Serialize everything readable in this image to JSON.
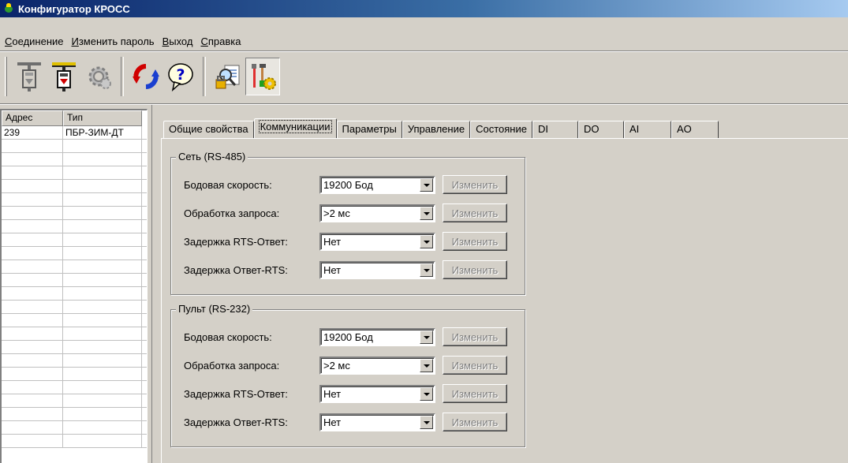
{
  "window": {
    "title": "Конфигуратор КРОСС"
  },
  "menu": [
    "Соединение",
    "Изменить пароль",
    "Выход",
    "Справка"
  ],
  "toolbar": {
    "icons": [
      "connect-device-icon",
      "disconnect-device-icon",
      "settings-gear-icon",
      "refresh-icon",
      "help-icon",
      "search-doc-icon",
      "tools-config-icon"
    ]
  },
  "devices": {
    "headers": [
      "Адрес",
      "Тип"
    ],
    "rows": [
      {
        "address": "239",
        "type": "ПБР-ЗИМ-ДТ"
      }
    ]
  },
  "tabs": [
    "Общие свойства",
    "Коммуникации",
    "Параметры",
    "Управление",
    "Состояние",
    "DI",
    "DO",
    "AI",
    "AO"
  ],
  "active_tab": "Коммуникации",
  "groups": {
    "net": {
      "title": "Сеть  (RS-485)",
      "rows": [
        {
          "label": "Бодовая скорость:",
          "value": "19200 Бод",
          "button": "Изменить"
        },
        {
          "label": "Обработка запроса:",
          "value": ">2 мс",
          "button": "Изменить"
        },
        {
          "label": "Задержка RTS-Ответ:",
          "value": "Нет",
          "button": "Изменить"
        },
        {
          "label": "Задержка Ответ-RTS:",
          "value": "Нет",
          "button": "Изменить"
        }
      ]
    },
    "remote": {
      "title": "Пульт (RS-232)",
      "rows": [
        {
          "label": "Бодовая скорость:",
          "value": "19200 Бод",
          "button": "Изменить"
        },
        {
          "label": "Обработка запроса:",
          "value": ">2 мс",
          "button": "Изменить"
        },
        {
          "label": "Задержка RTS-Ответ:",
          "value": "Нет",
          "button": "Изменить"
        },
        {
          "label": "Задержка Ответ-RTS:",
          "value": "Нет",
          "button": "Изменить"
        }
      ]
    }
  }
}
